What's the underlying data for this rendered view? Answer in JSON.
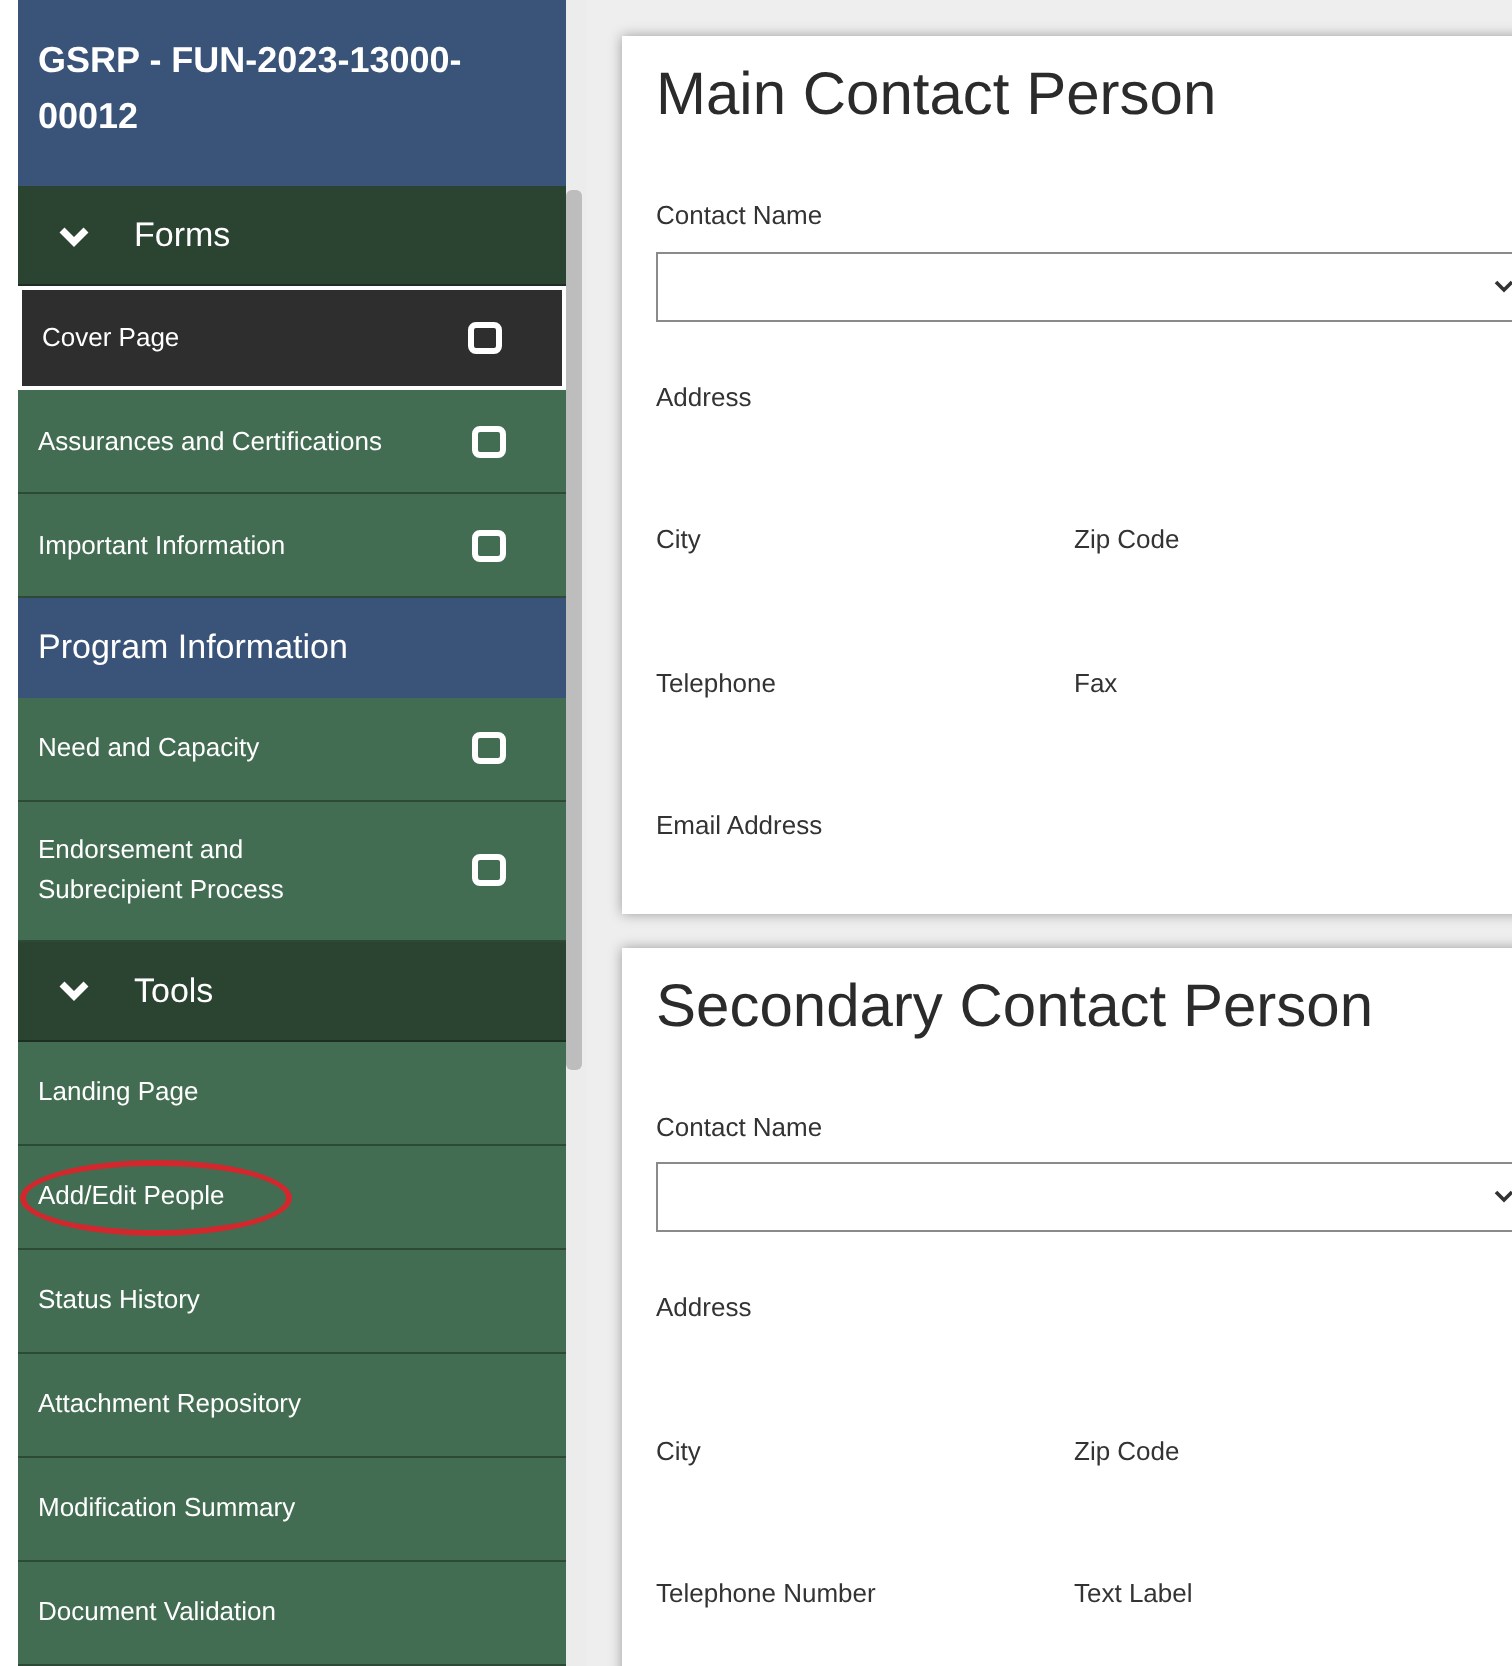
{
  "sidebar": {
    "title": "GSRP - FUN-2023-13000-00012",
    "items": [
      {
        "kind": "group",
        "label": "Forms",
        "expanded": true
      },
      {
        "kind": "form",
        "label": "Cover Page",
        "selected": true,
        "checked": false,
        "circled": false
      },
      {
        "kind": "form",
        "label": "Assurances and Certifications",
        "selected": false,
        "checked": false,
        "circled": false
      },
      {
        "kind": "form",
        "label": "Important Information",
        "selected": false,
        "checked": false,
        "circled": false
      },
      {
        "kind": "section",
        "label": "Program Information"
      },
      {
        "kind": "form",
        "label": "Need and Capacity",
        "selected": false,
        "checked": false,
        "circled": false
      },
      {
        "kind": "form",
        "label": "Endorsement and Subrecipient Process",
        "selected": false,
        "checked": false,
        "circled": false
      },
      {
        "kind": "group",
        "label": "Tools",
        "expanded": true
      },
      {
        "kind": "link",
        "label": "Landing Page",
        "selected": false,
        "circled": false
      },
      {
        "kind": "link",
        "label": "Add/Edit People",
        "selected": false,
        "circled": true
      },
      {
        "kind": "link",
        "label": "Status History",
        "selected": false,
        "circled": false
      },
      {
        "kind": "link",
        "label": "Attachment Repository",
        "selected": false,
        "circled": false
      },
      {
        "kind": "link",
        "label": "Modification Summary",
        "selected": false,
        "circled": false
      },
      {
        "kind": "link",
        "label": "Document Validation",
        "selected": false,
        "circled": false
      }
    ]
  },
  "cards": [
    {
      "title": "Main Contact Person",
      "rows": [
        {
          "kind": "select",
          "labels": [
            "Contact Name"
          ]
        },
        {
          "kind": "text",
          "labels": [
            "Address"
          ]
        },
        {
          "kind": "text",
          "labels": [
            "City",
            "Zip Code"
          ]
        },
        {
          "kind": "text",
          "labels": [
            "Telephone",
            "Fax"
          ]
        },
        {
          "kind": "text",
          "labels": [
            "Email Address"
          ]
        }
      ]
    },
    {
      "title": "Secondary Contact Person",
      "rows": [
        {
          "kind": "select",
          "labels": [
            "Contact Name"
          ]
        },
        {
          "kind": "text",
          "labels": [
            "Address"
          ]
        },
        {
          "kind": "text",
          "labels": [
            "City",
            "Zip Code"
          ]
        },
        {
          "kind": "text",
          "labels": [
            "Telephone Number",
            "Text Label"
          ]
        }
      ]
    }
  ]
}
